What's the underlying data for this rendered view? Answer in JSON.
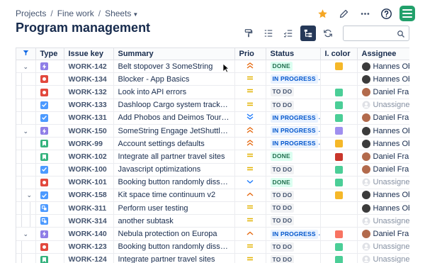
{
  "breadcrumb": {
    "items": [
      "Projects",
      "Fine work",
      "Sheets"
    ],
    "separator": "/"
  },
  "page": {
    "title": "Program management"
  },
  "search": {
    "placeholder": ""
  },
  "columns": {
    "type": "Type",
    "issue_key": "Issue key",
    "summary": "Summary",
    "prio": "Prio",
    "status": "Status",
    "color": "I. color",
    "assignee": "Assignee"
  },
  "colors": {
    "epic": "#8f7ee7",
    "bug": "#e2483d",
    "task": "#4c9aff",
    "story": "#36b37e",
    "subtask": "#4c9aff",
    "prio_high": "#e56910",
    "prio_medium": "#e2b203",
    "prio_low": "#1d7afc",
    "star": "#f5a623",
    "brand": "#22a06b"
  },
  "rows": [
    {
      "ctrl": "collapse",
      "type": "epic",
      "key": "WORK-142",
      "summary": "Belt stopover 3 SomeString",
      "prio": "highest",
      "status": "DONE",
      "status_kind": "done",
      "color": "#f5b829",
      "assignee": "Hannes Obweger",
      "avatar": "#3b3b3b"
    },
    {
      "ctrl": "",
      "type": "bug",
      "key": "WORK-134",
      "summary": "Blocker - App Basics",
      "prio": "medium",
      "status": "IN PROGRESS",
      "status_kind": "inprogress",
      "color": "",
      "assignee": "Hannes Obweger",
      "avatar": "#3b3b3b"
    },
    {
      "ctrl": "",
      "type": "bug",
      "key": "WORK-132",
      "summary": "Look into API errors",
      "prio": "medium",
      "status": "TO DO",
      "status_kind": "todo",
      "color": "#4bce97",
      "assignee": "Daniel Franz",
      "avatar": "#b26a4c"
    },
    {
      "ctrl": "",
      "type": "task",
      "key": "WORK-133",
      "summary": "Dashloop Cargo system tracker email s…",
      "prio": "medium",
      "status": "TO DO",
      "status_kind": "todo",
      "color": "#4bce97",
      "assignee": "Unassigned",
      "avatar": ""
    },
    {
      "ctrl": "",
      "type": "task",
      "key": "WORK-131",
      "summary": "Add Phobos and Deimos Tours as a Pre…",
      "prio": "lowest",
      "status": "IN PROGRESS",
      "status_kind": "inprogress",
      "color": "#4bce97",
      "assignee": "Daniel Franz",
      "avatar": "#b26a4c"
    },
    {
      "ctrl": "collapse",
      "type": "epic",
      "key": "WORK-150",
      "summary": "SomeString Engage JetShuttle SpaceW…",
      "prio": "highest",
      "status": "IN PROGRESS",
      "status_kind": "inprogress",
      "color": "#9f8fef",
      "assignee": "Hannes Obweger",
      "avatar": "#3b3b3b"
    },
    {
      "ctrl": "",
      "type": "story",
      "key": "WORK-99",
      "summary": "Account settings defaults",
      "prio": "highest",
      "status": "IN PROGRESS",
      "status_kind": "inprogress",
      "color": "#f5b829",
      "assignee": "Hannes Obweger",
      "avatar": "#3b3b3b"
    },
    {
      "ctrl": "",
      "type": "story",
      "key": "WORK-102",
      "summary": "Integrate all partner travel sites",
      "prio": "medium",
      "status": "DONE",
      "status_kind": "done",
      "color": "#c9372c",
      "assignee": "Daniel Franz",
      "avatar": "#b26a4c"
    },
    {
      "ctrl": "",
      "type": "task",
      "key": "WORK-100",
      "summary": "Javascript optimizations",
      "prio": "medium",
      "status": "TO DO",
      "status_kind": "todo",
      "color": "#4bce97",
      "assignee": "Daniel Franz",
      "avatar": "#b26a4c"
    },
    {
      "ctrl": "",
      "type": "bug",
      "key": "WORK-101",
      "summary": "Booking button randomly dissapears",
      "prio": "low",
      "status": "DONE",
      "status_kind": "done",
      "color": "#4bce97",
      "assignee": "Unassigned",
      "avatar": ""
    },
    {
      "ctrl": "collapse-sub",
      "type": "task",
      "key": "WORK-158",
      "summary": "Kit space time continuum v2",
      "prio": "high",
      "status": "TO DO",
      "status_kind": "todo",
      "color": "#f5b829",
      "assignee": "Hannes Obweger",
      "avatar": "#3b3b3b"
    },
    {
      "ctrl": "sub",
      "type": "subtask",
      "key": "WORK-311",
      "summary": "Perform user testing",
      "prio": "medium",
      "status": "TO DO",
      "status_kind": "todo",
      "color": "",
      "assignee": "Hannes Obweger",
      "avatar": "#3b3b3b"
    },
    {
      "ctrl": "sub",
      "type": "subtask",
      "key": "WORK-314",
      "summary": "another subtask",
      "prio": "medium",
      "status": "TO DO",
      "status_kind": "todo",
      "color": "",
      "assignee": "Unassigned",
      "avatar": ""
    },
    {
      "ctrl": "collapse",
      "type": "epic",
      "key": "WORK-140",
      "summary": "Nebula protection on Europa",
      "prio": "high",
      "status": "IN PROGRESS",
      "status_kind": "inprogress",
      "color": "#f87462",
      "assignee": "Daniel Franz",
      "avatar": "#b26a4c"
    },
    {
      "ctrl": "",
      "type": "bug",
      "key": "WORK-123",
      "summary": "Booking button randomly dissapears",
      "prio": "medium",
      "status": "TO DO",
      "status_kind": "todo",
      "color": "#4bce97",
      "assignee": "Unassigned",
      "avatar": ""
    },
    {
      "ctrl": "",
      "type": "story",
      "key": "WORK-124",
      "summary": "Integrate partner travel sites",
      "prio": "medium",
      "status": "TO DO",
      "status_kind": "todo",
      "color": "#4bce97",
      "assignee": "Unassigned",
      "avatar": ""
    }
  ]
}
